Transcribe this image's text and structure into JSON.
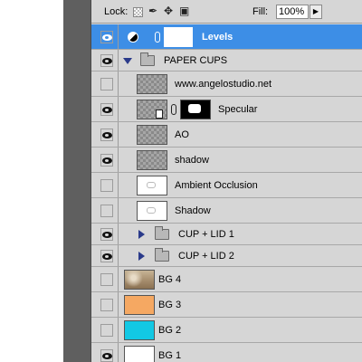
{
  "toolbar": {
    "lock_label": "Lock:",
    "fill_label": "Fill:",
    "fill_value": "100%"
  },
  "icons": {
    "lock_transparent": "checkerboard-icon",
    "lock_brush": "brush-icon",
    "lock_move": "move-icon",
    "lock_all": "lock-icon",
    "visibility": "eye-icon",
    "group": "folder-icon"
  },
  "colors": {
    "selection": "#3d8ee6",
    "bg3_swatch": "#f5a862",
    "bg2_swatch": "#12c8e4"
  },
  "layers": [
    {
      "name": "Levels",
      "visible": true,
      "selected": true
    },
    {
      "name": "PAPER CUPS",
      "visible": true,
      "expanded": true
    },
    {
      "name": "www.angelostudio.net",
      "visible": false
    },
    {
      "name": "Specular",
      "visible": true
    },
    {
      "name": "AO",
      "visible": true
    },
    {
      "name": "shadow",
      "visible": true
    },
    {
      "name": "Ambient Occlusion",
      "visible": false
    },
    {
      "name": "Shadow",
      "visible": false
    },
    {
      "name": "CUP + LID 1",
      "visible": true,
      "expanded": false
    },
    {
      "name": "CUP + LID 2",
      "visible": true,
      "expanded": false
    },
    {
      "name": "BG 4",
      "visible": false
    },
    {
      "name": "BG 3",
      "visible": false
    },
    {
      "name": "BG 2",
      "visible": false
    },
    {
      "name": "BG 1",
      "visible": true
    }
  ]
}
